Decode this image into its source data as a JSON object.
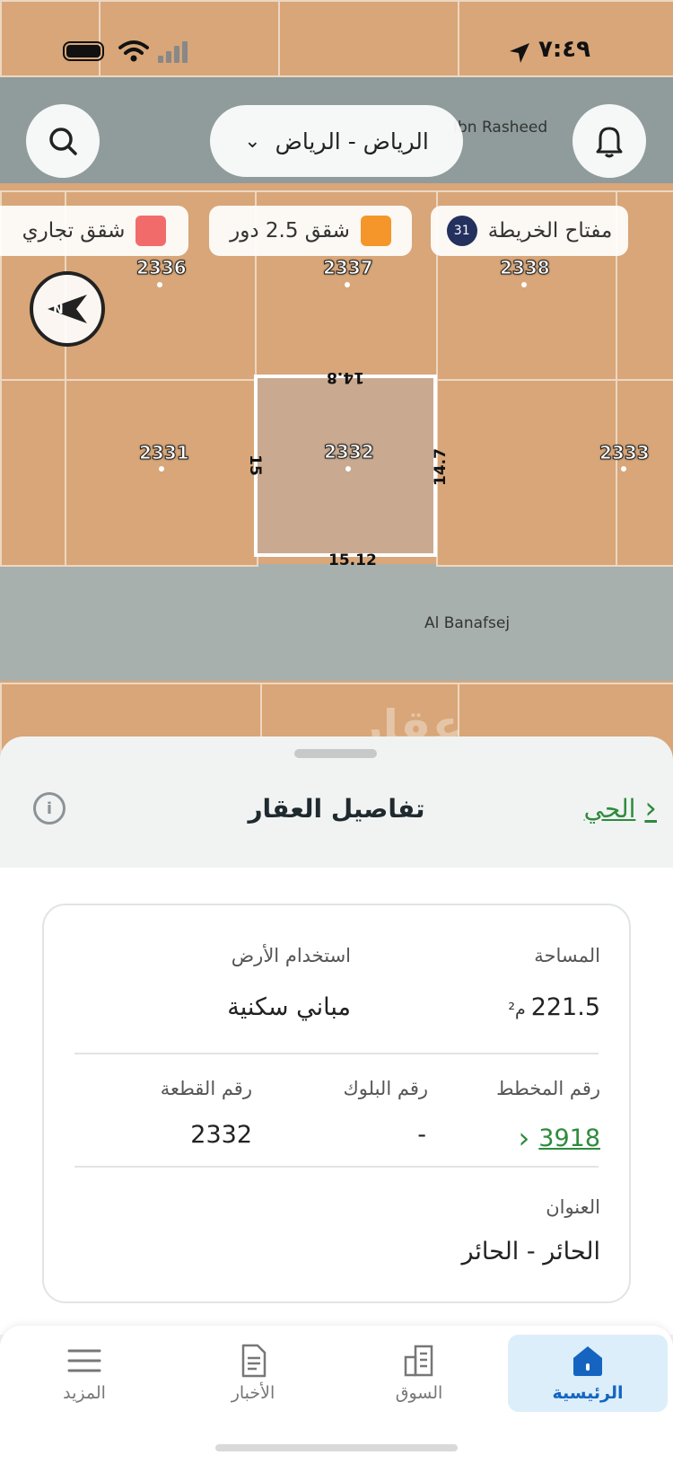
{
  "status_bar": {
    "time": "٧:٤٩"
  },
  "map": {
    "city_select": "الرياض - الرياض",
    "legend": {
      "map_key_label": "مفتاح الخريطة",
      "map_key_count": "31",
      "item_2": "شقق 2.5 دور",
      "item_3": "شقق تجاري"
    },
    "plots": [
      "2336",
      "2337",
      "2338",
      "2331",
      "2332",
      "2333"
    ],
    "dimensions": {
      "top": "14.8",
      "bottom": "15.12",
      "left": "15",
      "right": "14.7"
    },
    "streets": {
      "top": "Ibn Rasheed",
      "bottom": "Al Banafsej"
    },
    "watermark": "عقار"
  },
  "sheet": {
    "title": "تفاصيل العقار",
    "neighborhood_link": "الحي"
  },
  "details": {
    "area_label": "المساحة",
    "area_value": "221.5",
    "area_unit": "م²",
    "land_use_label": "استخدام الأرض",
    "land_use_value": "مباني سكنية",
    "plan_label": "رقم المخطط",
    "plan_value": "3918",
    "block_label": "رقم البلوك",
    "block_value": "-",
    "plot_label": "رقم القطعة",
    "plot_value": "2332",
    "address_label": "العنوان",
    "address_value": "الحائر - الحائر"
  },
  "tabs": {
    "home": "الرئيسية",
    "market": "السوق",
    "news": "الأخبار",
    "more": "المزيد"
  },
  "colors": {
    "accent_green": "#2e8b3d",
    "legend_orange": "#f5962a",
    "legend_red": "#f26b6b",
    "active_tab": "#1565c0"
  }
}
